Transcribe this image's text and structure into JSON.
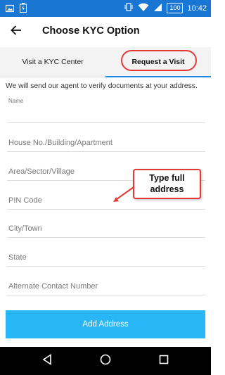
{
  "status_bar": {
    "time": "10:42",
    "battery": "100",
    "background": "#1976d2",
    "icons": [
      "image-icon",
      "battery-charging-icon",
      "vibrate-icon",
      "wifi-icon",
      "cell-signal-icon",
      "battery-icon"
    ]
  },
  "app_bar": {
    "title": "Choose KYC Option",
    "back_icon": "arrow-back-icon"
  },
  "tabs": [
    {
      "label": "Visit a KYC Center",
      "selected": false
    },
    {
      "label": "Request a Visit",
      "selected": true
    }
  ],
  "form": {
    "info_text": "We will send our agent to verify documents at your address.",
    "name_label": "Name",
    "fields": [
      {
        "placeholder": "House No./Building/Apartment",
        "value": ""
      },
      {
        "placeholder": "Area/Sector/Village",
        "value": ""
      },
      {
        "placeholder": "PIN Code",
        "value": ""
      },
      {
        "placeholder": "City/Town",
        "value": ""
      },
      {
        "placeholder": "State",
        "value": ""
      },
      {
        "placeholder": "Alternate Contact Number",
        "value": ""
      }
    ],
    "submit_label": "Add Address"
  },
  "annotation": {
    "text": "Type full address",
    "color": "#e53935"
  },
  "colors": {
    "accent": "#1e88e5",
    "button": "#29b6f6",
    "highlight": "#e53935"
  }
}
